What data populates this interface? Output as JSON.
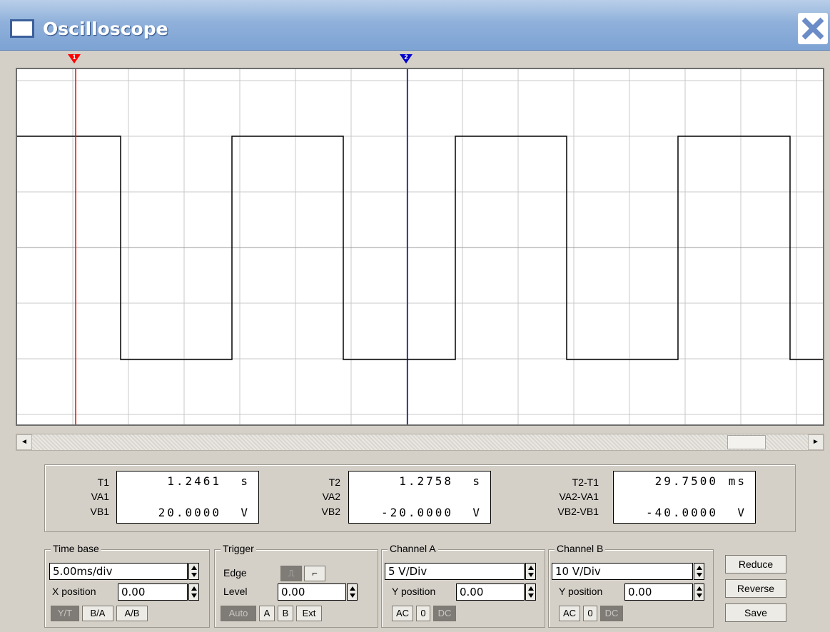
{
  "window": {
    "title": "Oscilloscope"
  },
  "cursors": {
    "t1_label": "1",
    "t2_label": "2"
  },
  "readout": {
    "t1": {
      "t": "T1",
      "va": "VA1",
      "vb": "VB1",
      "t_value": "1.2461",
      "t_unit": "s",
      "vb_value": "20.0000",
      "vb_unit": "V"
    },
    "t2": {
      "t": "T2",
      "va": "VA2",
      "vb": "VB2",
      "t_value": "1.2758",
      "t_unit": "s",
      "vb_value": "-20.0000",
      "vb_unit": "V"
    },
    "diff": {
      "t": "T2-T1",
      "va": "VA2-VA1",
      "vb": "VB2-VB1",
      "t_value": "29.7500",
      "t_unit": "ms",
      "vb_value": "-40.0000",
      "vb_unit": "V"
    }
  },
  "timebase": {
    "legend": "Time base",
    "scale": "5.00ms/div",
    "xpos_label": "X position",
    "xpos": "0.00",
    "yt": "Y/T",
    "ba": "B/A",
    "ab": "A/B"
  },
  "trigger": {
    "legend": "Trigger",
    "edge_label": "Edge",
    "level_label": "Level",
    "level": "0.00",
    "auto": "Auto",
    "a": "A",
    "b": "B",
    "ext": "Ext"
  },
  "channel_a": {
    "legend": "Channel A",
    "scale": "5 V/Div",
    "ypos_label": "Y position",
    "ypos": "0.00",
    "ac": "AC",
    "zero": "0",
    "dc": "DC"
  },
  "channel_b": {
    "legend": "Channel B",
    "scale": "10 V/Div",
    "ypos_label": "Y position",
    "ypos": "0.00",
    "ac": "AC",
    "zero": "0",
    "dc": "DC"
  },
  "buttons": {
    "reduce": "Reduce",
    "reverse": "Reverse",
    "save": "Save"
  },
  "colors": {
    "cursor1": "#ff0000",
    "cursor2": "#0000cc",
    "trace": "#000000",
    "grid": "#c8c8c8"
  }
}
